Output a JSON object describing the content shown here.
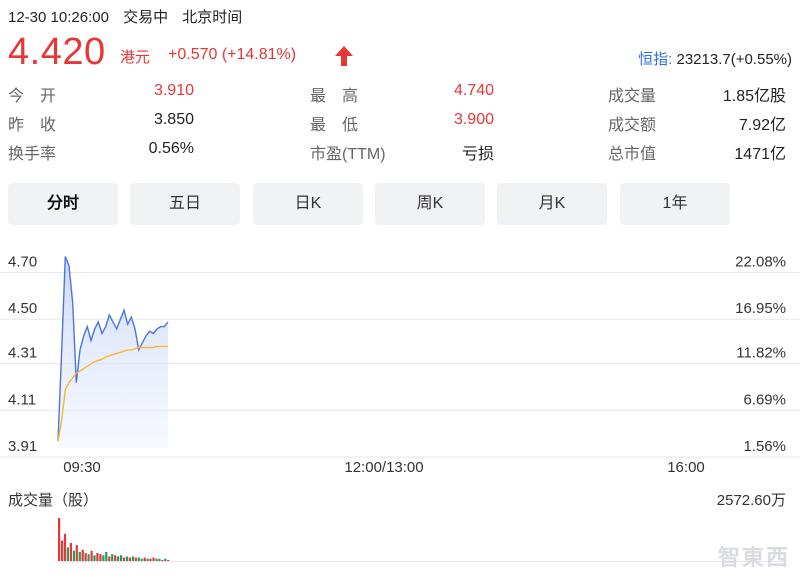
{
  "header": {
    "datetime": "12-30 10:26:00",
    "status": "交易中",
    "timezone": "北京时间"
  },
  "quote": {
    "price": "4.420",
    "currency": "港元",
    "change": "+0.570 (+14.81%)",
    "index_name": "恒指:",
    "index_value": "23213.7(+0.55%)"
  },
  "stats": [
    [
      {
        "label": "今　开",
        "value": "3.910",
        "color": "red"
      },
      {
        "label": "最　高",
        "value": "4.740",
        "color": "red"
      },
      {
        "label": "成交量",
        "value": "1.85亿股",
        "color": "dark"
      }
    ],
    [
      {
        "label": "昨　收",
        "value": "3.850",
        "color": "dark"
      },
      {
        "label": "最　低",
        "value": "3.900",
        "color": "red"
      },
      {
        "label": "成交额",
        "value": "7.92亿",
        "color": "dark"
      }
    ],
    [
      {
        "label": "换手率",
        "value": "0.56%",
        "color": "dark"
      },
      {
        "label": "市盈(TTM)",
        "value": "亏损",
        "color": "dark"
      },
      {
        "label": "总市值",
        "value": "1471亿",
        "color": "dark"
      }
    ]
  ],
  "tabs": [
    {
      "label": "分时",
      "active": true
    },
    {
      "label": "五日",
      "active": false
    },
    {
      "label": "日K",
      "active": false
    },
    {
      "label": "周K",
      "active": false
    },
    {
      "label": "月K",
      "active": false
    },
    {
      "label": "1年",
      "active": false
    }
  ],
  "colors": {
    "up": "#e83535",
    "down": "#1f9e5a",
    "price_line": "#4a74e8",
    "avg_line": "#f5b82e",
    "grid": "#e6e7ea",
    "index_link": "#2f6fe0"
  },
  "chart_data": {
    "type": "line",
    "y_price_ticks": [
      "4.70",
      "4.50",
      "4.31",
      "4.11",
      "3.91"
    ],
    "y_price_values": [
      4.7,
      4.5,
      4.31,
      4.11,
      3.91
    ],
    "y_pct_ticks": [
      "22.08%",
      "16.95%",
      "11.82%",
      "6.69%",
      "1.56%"
    ],
    "x_ticks": [
      "09:30",
      "12:00/13:00",
      "16:00"
    ],
    "ylim": [
      3.88,
      4.745
    ],
    "series": [
      {
        "values": [
          3.91,
          4.3,
          4.7,
          4.66,
          4.5,
          4.16,
          4.3,
          4.36,
          4.4,
          4.34,
          4.39,
          4.42,
          4.37,
          4.4,
          4.45,
          4.42,
          4.39,
          4.43,
          4.47,
          4.41,
          4.44,
          4.39,
          4.3,
          4.33,
          4.36,
          4.38,
          4.37,
          4.39,
          4.4,
          4.4,
          4.42
        ]
      },
      {
        "values": [
          3.91,
          4.0,
          4.13,
          4.16,
          4.18,
          4.2,
          4.21,
          4.22,
          4.23,
          4.24,
          4.25,
          4.255,
          4.26,
          4.27,
          4.275,
          4.28,
          4.285,
          4.29,
          4.295,
          4.3,
          4.3,
          4.305,
          4.31,
          4.31,
          4.31,
          4.31,
          4.31,
          4.315,
          4.315,
          4.315,
          4.315
        ]
      }
    ],
    "volume_label": "成交量（股）",
    "volume_max_label": "2572.60万",
    "volume": [
      38,
      18,
      24,
      12,
      16,
      9,
      14,
      8,
      10,
      7,
      6,
      9,
      5,
      7,
      6,
      5,
      8,
      4,
      6,
      5,
      4,
      5,
      3,
      4,
      3,
      4,
      3,
      3,
      2,
      3,
      2,
      2,
      3,
      2,
      2,
      1,
      2,
      1
    ],
    "volume_colors": [
      "up",
      "up",
      "up",
      "down",
      "up",
      "down",
      "up",
      "down",
      "up",
      "up",
      "down",
      "up",
      "down",
      "up",
      "up",
      "down",
      "down",
      "up",
      "down",
      "up",
      "down",
      "down",
      "up",
      "down",
      "up",
      "down",
      "up",
      "down",
      "down",
      "up",
      "down",
      "up",
      "up",
      "down",
      "down",
      "up",
      "down",
      "up"
    ]
  },
  "watermark": "智東西"
}
